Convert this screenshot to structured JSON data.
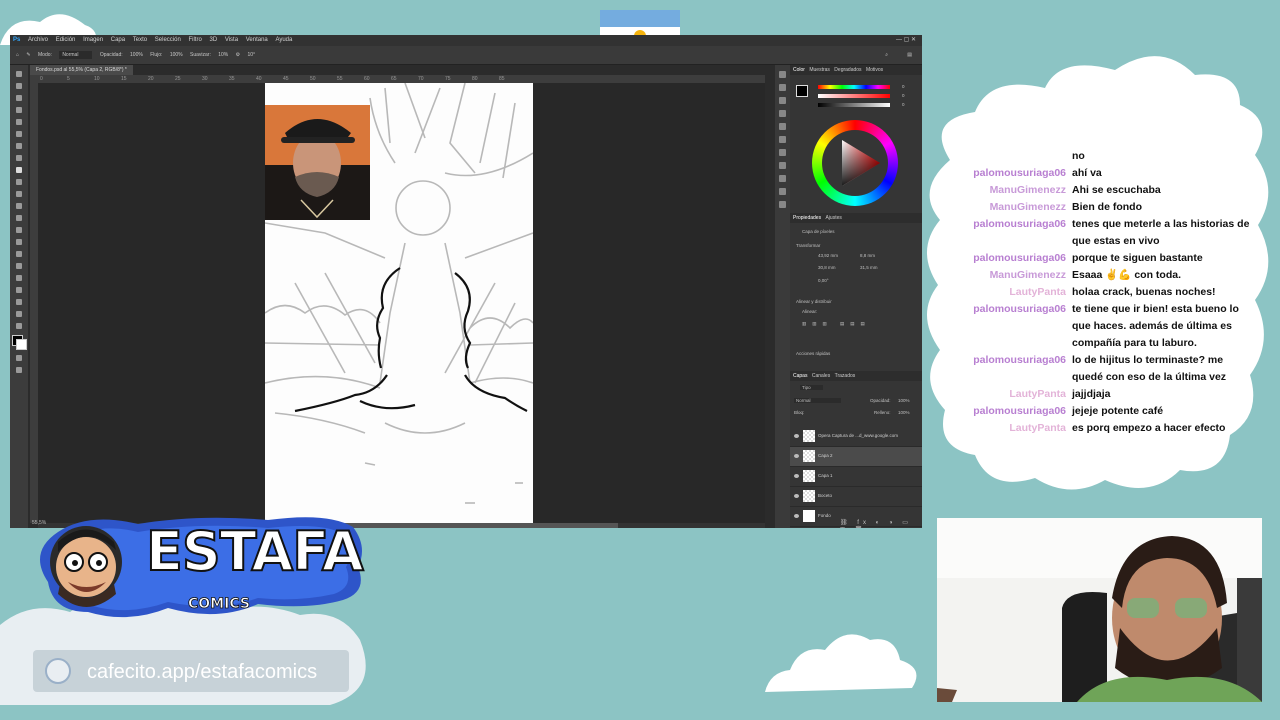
{
  "photoshop": {
    "menu": [
      "Archivo",
      "Edición",
      "Imagen",
      "Capa",
      "Texto",
      "Selección",
      "Filtro",
      "3D",
      "Vista",
      "Ventana",
      "Ayuda"
    ],
    "options": {
      "mode_label": "Modo:",
      "mode_value": "Normal",
      "opacity_label": "Opacidad:",
      "opacity_value": "100%",
      "flow_label": "Flujo:",
      "flow_value": "100%",
      "smooth_label": "Suavizar:",
      "smooth_value": "10%",
      "angle_value": "10°"
    },
    "document_tab": "Fondos.psd al 55,5% (Capa 2, RGB/8*) *",
    "ruler_marks": [
      "0",
      "5",
      "10",
      "15",
      "20",
      "25",
      "30",
      "35",
      "40",
      "45",
      "50",
      "55",
      "60",
      "65",
      "70",
      "75",
      "80",
      "85"
    ],
    "zoom": "55,5%",
    "color_tabs": [
      "Color",
      "Muestras",
      "Degradados",
      "Motivos"
    ],
    "color_values": {
      "h": "0",
      "s": "0",
      "b": "0"
    },
    "properties": {
      "tabs": [
        "Propiedades",
        "Ajustes"
      ],
      "layer_type": "Capa de píxeles",
      "transform_title": "Transformar",
      "an": "43,92 mm",
      "al": "30,8 mm",
      "x": "8,8 mm",
      "y": "31,5 mm",
      "angle": "0,00°",
      "align_title": "Alinear y distribuir",
      "align_label": "Alinear:",
      "hidden_title": "Acciones rápidas"
    },
    "layers": {
      "tabs": [
        "Capas",
        "Canales",
        "Trazados"
      ],
      "kind": "Tipo",
      "blend": "Normal",
      "opacity_label": "Opacidad:",
      "opacity": "100%",
      "lock_label": "Bloq:",
      "fill_label": "Relleno:",
      "fill": "100%",
      "items": [
        {
          "name": "Opera Captura de ...d_www.google.com"
        },
        {
          "name": "Capa 2"
        },
        {
          "name": "Capa 1"
        },
        {
          "name": "Boceto"
        },
        {
          "name": "Fondo"
        }
      ]
    }
  },
  "chat": [
    {
      "user": "",
      "message": "no",
      "color": "#b87fd1"
    },
    {
      "user": "palomousuriaga06",
      "message": "ahí va",
      "color": "#b87fd1"
    },
    {
      "user": "ManuGimenezz",
      "message": "Ahi se escuchaba",
      "color": "#c89ad8"
    },
    {
      "user": "ManuGimenezz",
      "message": "Bien de fondo",
      "color": "#c89ad8"
    },
    {
      "user": "palomousuriaga06",
      "message": "tenes que meterle a las historias de que estas en vivo",
      "color": "#b87fd1"
    },
    {
      "user": "palomousuriaga06",
      "message": "porque te siguen bastante",
      "color": "#b87fd1"
    },
    {
      "user": "ManuGimenezz",
      "message": "Esaaa ✌💪 con toda.",
      "color": "#c89ad8"
    },
    {
      "user": "LautyPanta",
      "message": "holaa crack, buenas noches!",
      "color": "#e3b3d8"
    },
    {
      "user": "palomousuriaga06",
      "message": "te tiene que ir bien! esta bueno lo que haces. además de última es compañía para tu laburo.",
      "color": "#b87fd1"
    },
    {
      "user": "palomousuriaga06",
      "message": "lo de hijitus lo terminaste? me quedé con eso de la última vez",
      "color": "#b87fd1"
    },
    {
      "user": "LautyPanta",
      "message": "jajjdjaja",
      "color": "#e3b3d8"
    },
    {
      "user": "palomousuriaga06",
      "message": "jejeje potente café",
      "color": "#b87fd1"
    },
    {
      "user": "LautyPanta",
      "message": "es porq empezo a hacer efecto",
      "color": "#e3b3d8"
    }
  ],
  "logo": {
    "title": "ESTAFA",
    "subtitle": "COMICS"
  },
  "cafecito": {
    "text": "cafecito.app/estafacomics"
  }
}
